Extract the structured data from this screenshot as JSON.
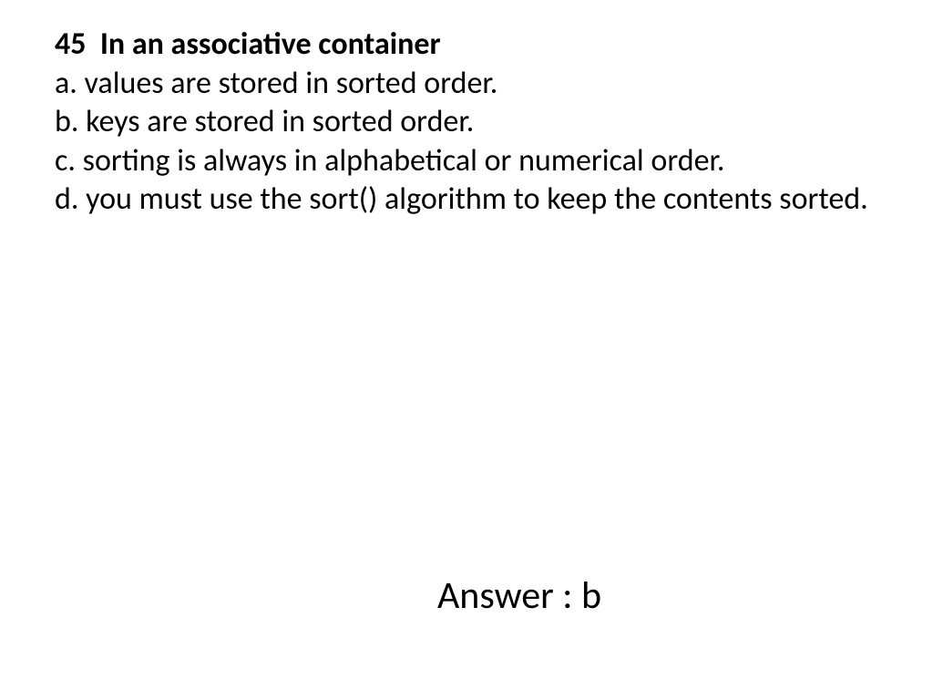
{
  "question": {
    "number": "45",
    "title": "In an associative container",
    "options": {
      "a": "a. values are stored in sorted order.",
      "b": "b. keys are stored in sorted order.",
      "c": "c. sorting is always in alphabetical or numerical order.",
      "d": "d. you must use the sort() algorithm to keep the contents sorted."
    }
  },
  "answer": {
    "label": "Answer : b"
  }
}
